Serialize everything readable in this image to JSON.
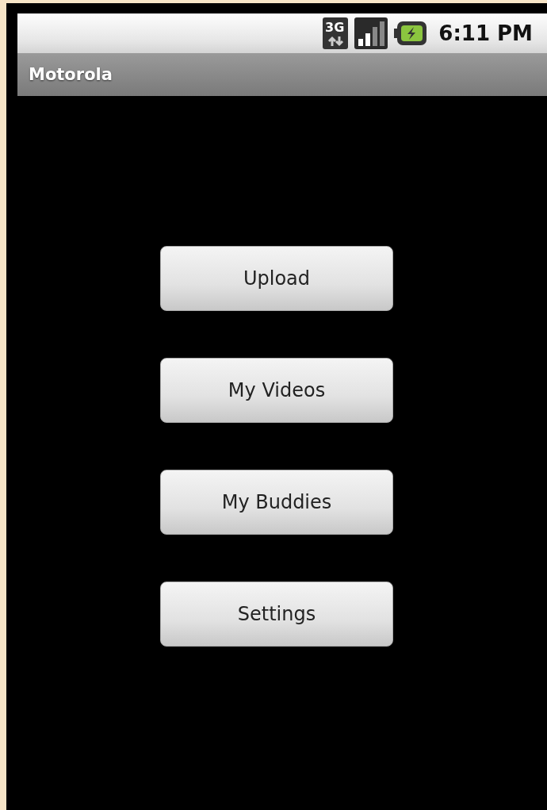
{
  "status_bar": {
    "network_type": "3G",
    "time": "6:11 PM"
  },
  "title_bar": {
    "title": "Motorola"
  },
  "buttons": [
    "Upload",
    "My Videos",
    "My Buddies",
    "Settings"
  ]
}
